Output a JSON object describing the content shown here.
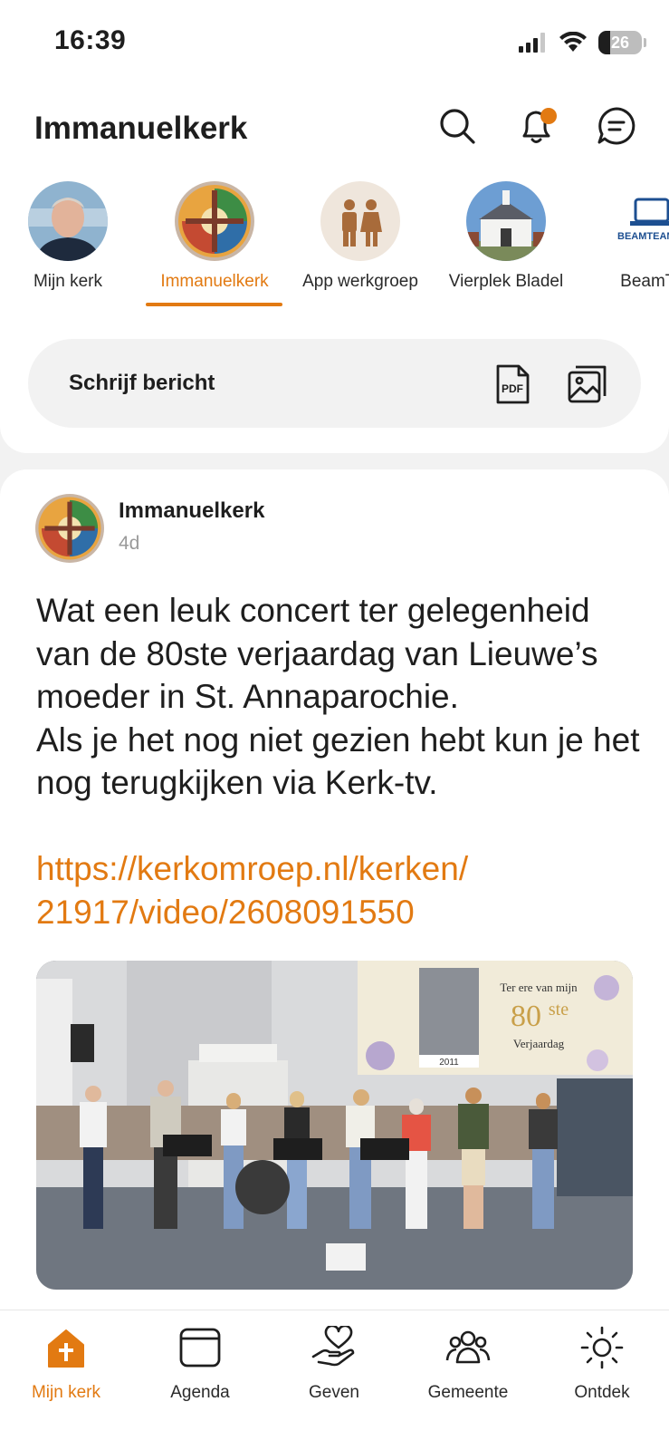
{
  "status_bar": {
    "time": "16:39",
    "battery": "26"
  },
  "header": {
    "title": "Immanuelkerk"
  },
  "header_icons": [
    "search-icon",
    "bell-icon",
    "chat-icon"
  ],
  "stories": [
    {
      "label": "Mijn kerk",
      "active": false
    },
    {
      "label": "Immanuelkerk",
      "active": true
    },
    {
      "label": "App werkgroep",
      "active": false
    },
    {
      "label": "Vierplek Bladel",
      "active": false
    },
    {
      "label": "BeamTe",
      "active": false
    }
  ],
  "compose": {
    "label": "Schrijf bericht",
    "pdf_label": "PDF"
  },
  "post": {
    "author": "Immanuelkerk",
    "time": "4d",
    "body": "Wat een leuk concert ter gelegenheid van de 80ste verjaardag van Lieuwe’s moeder in St. Annaparochie.\nAls je het nog niet gezien hebt kun je het nog terugkijken via Kerk-tv.",
    "link": "https://kerkomroep.nl/kerken/\n21917/video/2608091550",
    "image": {
      "banner_line1": "Ter ere van mijn",
      "banner_number": "80",
      "banner_suffix": "ste",
      "banner_line2": "Verjaardag",
      "photo_year": "2011"
    }
  },
  "tabbar": [
    {
      "label": "Mijn kerk",
      "icon": "home-icon",
      "active": true
    },
    {
      "label": "Agenda",
      "icon": "calendar-icon",
      "active": false
    },
    {
      "label": "Geven",
      "icon": "giving-hand-heart-icon",
      "active": false
    },
    {
      "label": "Gemeente",
      "icon": "people-group-icon",
      "active": false
    },
    {
      "label": "Ontdek",
      "icon": "sun-icon",
      "active": false
    }
  ],
  "colors": {
    "accent": "#e27a12",
    "text": "#1e1e1e",
    "muted": "#9a9a9a",
    "background": "#f2f2f2"
  }
}
